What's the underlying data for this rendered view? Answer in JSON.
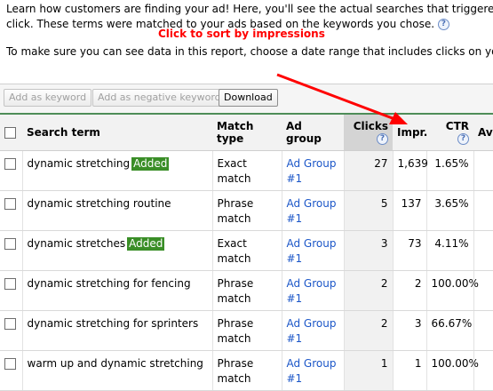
{
  "intro": {
    "line1": "Learn how customers are finding your ad! Here, you'll see the actual searches that triggered yo",
    "line2": "click. These terms were matched to your ads based on the keywords you chose.",
    "help_glyph": "?"
  },
  "annotation": "Click to sort by impressions",
  "range_text": "To make sure you can see data in this report, choose a date range that includes clicks on your",
  "toolbar": {
    "add_keyword": "Add as keyword",
    "add_negative": "Add as negative keyword",
    "download": "Download"
  },
  "table": {
    "headers": {
      "search_term": "Search term",
      "match_type": "Match type",
      "ad_group": "Ad group",
      "clicks": "Clicks",
      "impr": "Impr.",
      "ctr": "CTR",
      "avg": "Av"
    },
    "added_label": "Added",
    "rows": [
      {
        "term": "dynamic stretching",
        "added": true,
        "match": "Exact match",
        "group": "Ad Group #1",
        "clicks": "27",
        "impr": "1,639",
        "ctr": "1.65%"
      },
      {
        "term": "dynamic stretching routine",
        "added": false,
        "match": "Phrase match",
        "group": "Ad Group #1",
        "clicks": "5",
        "impr": "137",
        "ctr": "3.65%"
      },
      {
        "term": "dynamic stretches",
        "added": true,
        "match": "Exact match",
        "group": "Ad Group #1",
        "clicks": "3",
        "impr": "73",
        "ctr": "4.11%"
      },
      {
        "term": "dynamic stretching for fencing",
        "added": false,
        "match": "Phrase match",
        "group": "Ad Group #1",
        "clicks": "2",
        "impr": "2",
        "ctr": "100.00%"
      },
      {
        "term": "dynamic stretching for sprinters",
        "added": false,
        "match": "Phrase match",
        "group": "Ad Group #1",
        "clicks": "2",
        "impr": "3",
        "ctr": "66.67%"
      },
      {
        "term": "warm up and dynamic stretching",
        "added": false,
        "match": "Phrase match",
        "group": "Ad Group #1",
        "clicks": "1",
        "impr": "1",
        "ctr": "100.00%"
      }
    ]
  },
  "colors": {
    "accent_border": "#4e8d58",
    "added_badge": "#3a8e27",
    "link": "#1b56c8",
    "annotation": "#ff0000"
  }
}
